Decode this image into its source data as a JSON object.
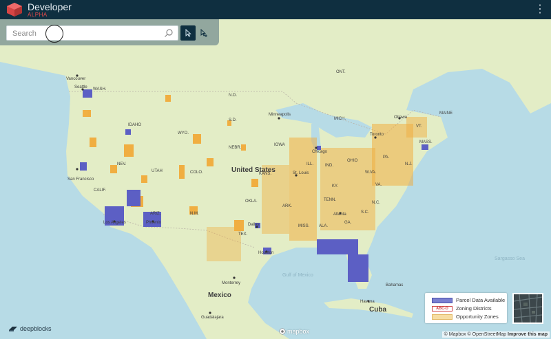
{
  "app": {
    "name": "Developer",
    "tag": "ALPHA"
  },
  "menu": {
    "kebab_glyph": "⋮"
  },
  "search": {
    "placeholder": "Search",
    "value": ""
  },
  "map_labels": {
    "countries": [
      "United States",
      "Mexico",
      "Cuba"
    ],
    "states": [
      "WASH.",
      "IDAHO",
      "WYO.",
      "N.D.",
      "S.D.",
      "NEBR.",
      "NEV.",
      "UTAH",
      "COLO.",
      "CALIF.",
      "ARIZ.",
      "N.M.",
      "OKLA.",
      "TEX.",
      "KANS.",
      "IOWA",
      "ILL.",
      "MICH.",
      "IND.",
      "OHIO",
      "KY.",
      "TENN.",
      "MISS.",
      "ALA.",
      "GA.",
      "S.C.",
      "N.C.",
      "VA.",
      "W.VA.",
      "PA.",
      "N.J.",
      "MASS.",
      "VT.",
      "MAINE",
      "ARK.",
      "ONT."
    ],
    "cities": [
      "Vancouver",
      "Seattle",
      "San Francisco",
      "Los Angeles",
      "Phoenix",
      "Dallas",
      "Houston",
      "Minneapolis",
      "Chicago",
      "St. Louis",
      "Atlanta",
      "Toronto",
      "Ottawa",
      "Monterrey",
      "Guadalajara",
      "Havana",
      "Bahamas"
    ],
    "water": [
      "Sargasso Sea",
      "Gulf of Mexico"
    ]
  },
  "legend": {
    "items": [
      {
        "label": "Parcel Data Available",
        "swatch_text": "",
        "color": "#7a7fd0",
        "border": "#4a4fa8"
      },
      {
        "label": "Zoning Districts",
        "swatch_text": "ABC-D",
        "color": "#ffffff",
        "border": "#d04444"
      },
      {
        "label": "Opportunity Zones",
        "swatch_text": "",
        "color": "#f6dda2",
        "border": "#e2b863"
      }
    ]
  },
  "footer": {
    "brand": "deepblocks",
    "mapbox": "mapbox",
    "attribution_prefix": "© Mapbox © OpenStreetMap",
    "attribution_link": "Improve this map"
  },
  "colors": {
    "topbar": "#0f2f40",
    "ocean": "#b7dbe6",
    "land": "#e6efc8",
    "opportunity": "#f2a833",
    "parcel": "#5c5fc4"
  }
}
